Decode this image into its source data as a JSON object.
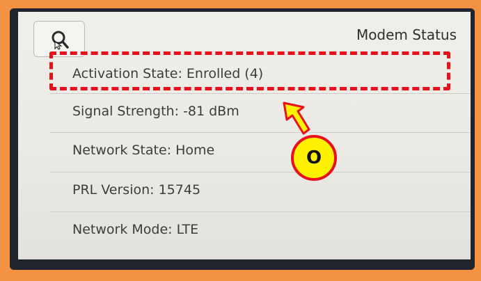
{
  "screen": {
    "title": "Modem Status",
    "search": {
      "icon": "search-icon"
    },
    "rows": [
      {
        "label": "Activation State: Enrolled (4)"
      },
      {
        "label": "Signal Strength: -81 dBm"
      },
      {
        "label": "Network State: Home"
      },
      {
        "label": "PRL Version: 15745"
      },
      {
        "label": "Network Mode: LTE"
      }
    ]
  },
  "annotation": {
    "badge_text": "O",
    "highlight_color": "#e8101a",
    "badge_color": "#fff200"
  },
  "colors": {
    "frame": "#f39242",
    "screen_bg": "#efede8",
    "text": "#3c3c3c"
  }
}
